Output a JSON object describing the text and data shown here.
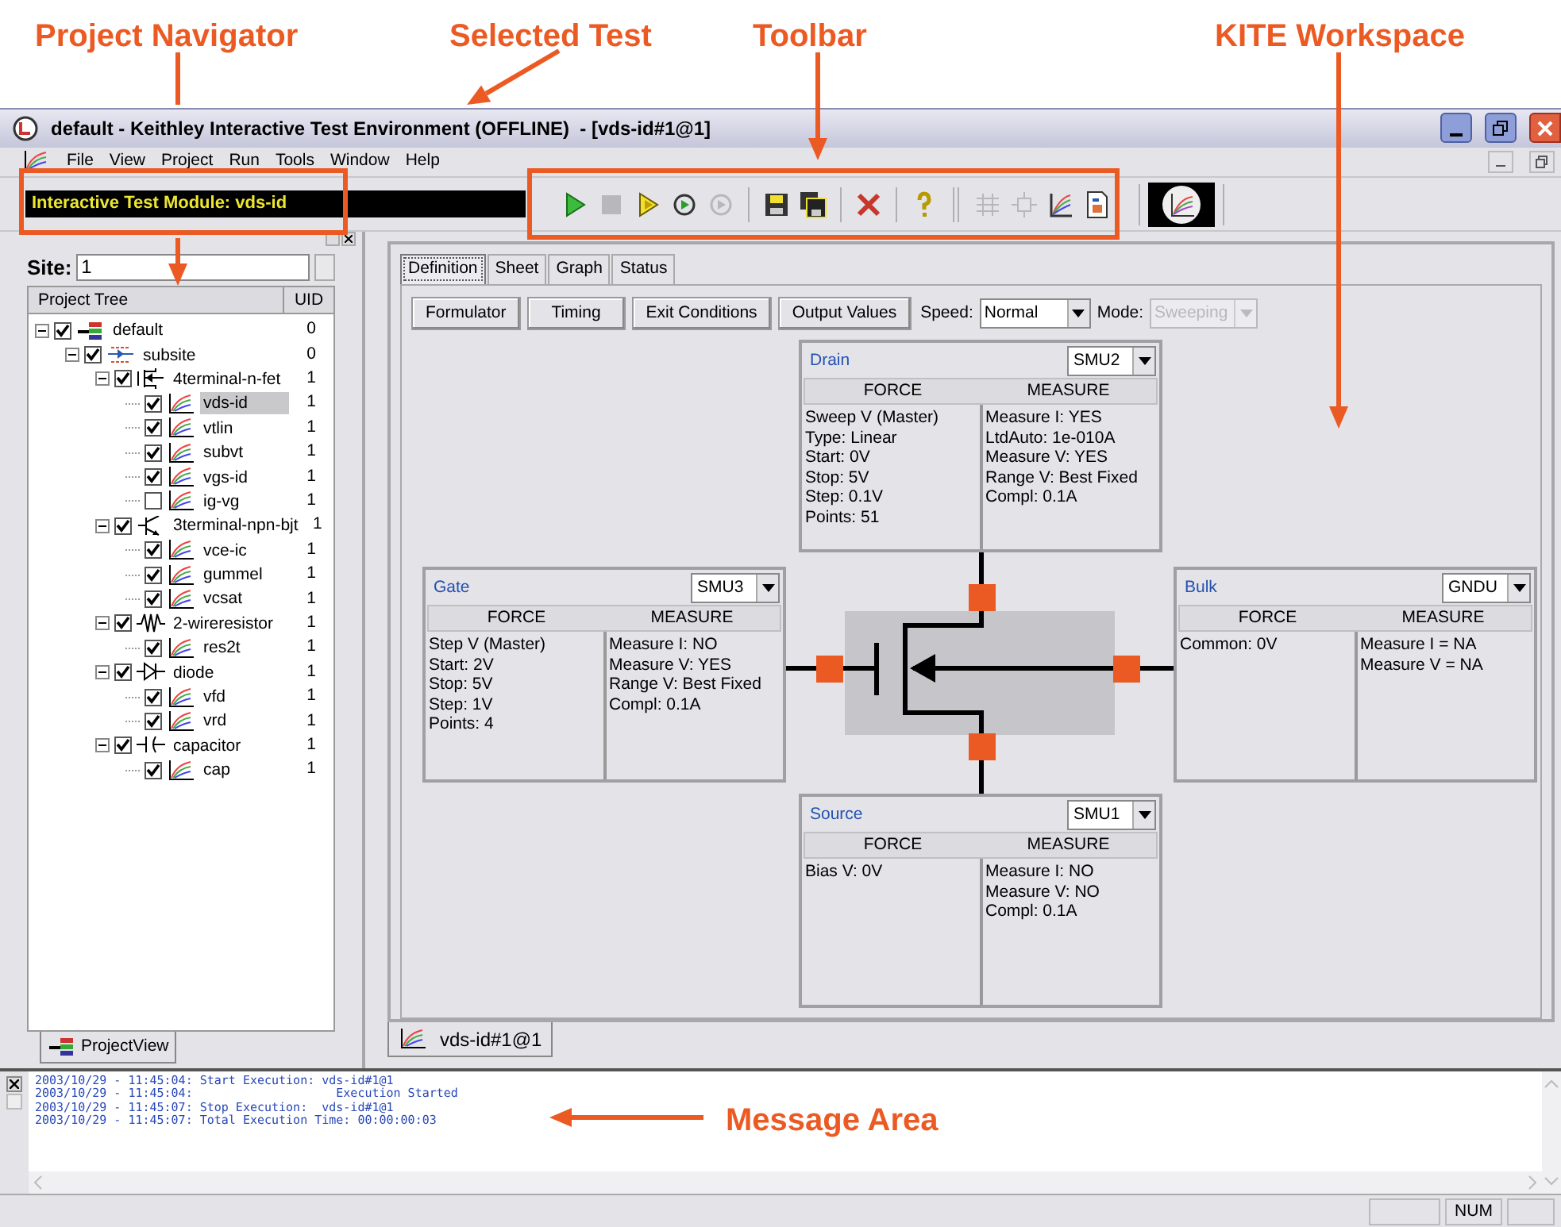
{
  "callouts": [
    {
      "text": "Project Navigator"
    },
    {
      "text": "Selected Test"
    },
    {
      "text": "Toolbar"
    },
    {
      "text": "KITE Workspace"
    },
    {
      "text": "Message Area"
    }
  ],
  "window": {
    "title": "default - Keithley Interactive Test Environment (OFFLINE)  - [vds-id#1@1]"
  },
  "menu": [
    "File",
    "View",
    "Project",
    "Run",
    "Tools",
    "Window",
    "Help"
  ],
  "toolbar": {
    "module_label": "Interactive Test Module: vds-id",
    "buttons": [
      {
        "kind": "run",
        "disabled": false
      },
      {
        "kind": "stop",
        "disabled": true
      },
      {
        "kind": "run-step",
        "disabled": false
      },
      {
        "kind": "cycle",
        "disabled": false
      },
      {
        "kind": "cycle",
        "disabled": true
      },
      {
        "kind": "sep"
      },
      {
        "kind": "save",
        "disabled": false
      },
      {
        "kind": "save-all",
        "disabled": false
      },
      {
        "kind": "sep"
      },
      {
        "kind": "delete",
        "disabled": false
      },
      {
        "kind": "sep"
      },
      {
        "kind": "help",
        "disabled": false
      },
      {
        "kind": "sep2"
      },
      {
        "kind": "grid",
        "disabled": true
      },
      {
        "kind": "chip",
        "disabled": true
      },
      {
        "kind": "graph",
        "disabled": false
      },
      {
        "kind": "doc",
        "disabled": false
      }
    ]
  },
  "site": {
    "label": "Site:",
    "value": "1"
  },
  "project_tree": {
    "columns": [
      "Project Tree",
      "UID"
    ],
    "nodes": [
      {
        "label": "default",
        "uid": "0",
        "kind": "project",
        "checked": true,
        "selected": false,
        "expanded": true,
        "children": [
          {
            "label": "subsite",
            "uid": "0",
            "kind": "subsite",
            "checked": true,
            "selected": false,
            "expanded": true,
            "children": [
              {
                "label": "4terminal-n-fet",
                "uid": "1",
                "kind": "fet",
                "checked": true,
                "selected": false,
                "expanded": true,
                "children": [
                  {
                    "label": "vds-id",
                    "uid": "1",
                    "kind": "test",
                    "checked": true,
                    "selected": true
                  },
                  {
                    "label": "vtlin",
                    "uid": "1",
                    "kind": "test",
                    "checked": true,
                    "selected": false
                  },
                  {
                    "label": "subvt",
                    "uid": "1",
                    "kind": "test",
                    "checked": true,
                    "selected": false
                  },
                  {
                    "label": "vgs-id",
                    "uid": "1",
                    "kind": "test",
                    "checked": true,
                    "selected": false
                  },
                  {
                    "label": "ig-vg",
                    "uid": "1",
                    "kind": "test",
                    "checked": false,
                    "selected": false
                  }
                ]
              },
              {
                "label": "3terminal-npn-bjt",
                "uid": "1",
                "kind": "bjt",
                "checked": true,
                "selected": false,
                "expanded": true,
                "children": [
                  {
                    "label": "vce-ic",
                    "uid": "1",
                    "kind": "test",
                    "checked": true,
                    "selected": false
                  },
                  {
                    "label": "gummel",
                    "uid": "1",
                    "kind": "test",
                    "checked": true,
                    "selected": false
                  },
                  {
                    "label": "vcsat",
                    "uid": "1",
                    "kind": "test",
                    "checked": true,
                    "selected": false
                  }
                ]
              },
              {
                "label": "2-wireresistor",
                "uid": "1",
                "kind": "resistor",
                "checked": true,
                "selected": false,
                "expanded": true,
                "children": [
                  {
                    "label": "res2t",
                    "uid": "1",
                    "kind": "test",
                    "checked": true,
                    "selected": false
                  }
                ]
              },
              {
                "label": "diode",
                "uid": "1",
                "kind": "diode",
                "checked": true,
                "selected": false,
                "expanded": true,
                "children": [
                  {
                    "label": "vfd",
                    "uid": "1",
                    "kind": "test",
                    "checked": true,
                    "selected": false
                  },
                  {
                    "label": "vrd",
                    "uid": "1",
                    "kind": "test",
                    "checked": true,
                    "selected": false
                  }
                ]
              },
              {
                "label": "capacitor",
                "uid": "1",
                "kind": "capacitor",
                "checked": true,
                "selected": false,
                "expanded": true,
                "children": [
                  {
                    "label": "cap",
                    "uid": "1",
                    "kind": "test",
                    "checked": true,
                    "selected": false
                  }
                ]
              }
            ]
          }
        ]
      }
    ]
  },
  "navigator_tab": {
    "label": "ProjectView"
  },
  "workspace": {
    "tabs": [
      {
        "label": "Definition",
        "selected": true
      },
      {
        "label": "Sheet",
        "selected": false
      },
      {
        "label": "Graph",
        "selected": false
      },
      {
        "label": "Status",
        "selected": false
      }
    ],
    "buttons": [
      "Formulator",
      "Timing",
      "Exit Conditions",
      "Output Values"
    ],
    "speed": {
      "label": "Speed:",
      "value": "Normal"
    },
    "mode": {
      "label": "Mode:",
      "value": "Sweeping",
      "disabled": true
    },
    "terminals": [
      {
        "name": "Drain",
        "instrument": "SMU2",
        "columns": [
          "FORCE",
          "MEASURE"
        ],
        "force": [
          "Sweep V (Master)",
          "Type: Linear",
          "Start: 0V",
          "Stop: 5V",
          "Step: 0.1V",
          "Points: 51"
        ],
        "measure": [
          "Measure I: YES",
          "LtdAuto: 1e-010A",
          "Measure V: YES",
          "Range V: Best Fixed",
          "Compl: 0.1A"
        ]
      },
      {
        "name": "Gate",
        "instrument": "SMU3",
        "columns": [
          "FORCE",
          "MEASURE"
        ],
        "force": [
          "Step V (Master)",
          "Start: 2V",
          "Stop: 5V",
          "Step: 1V",
          "Points: 4"
        ],
        "measure": [
          "Measure I: NO",
          "Measure V: YES",
          "Range V: Best Fixed",
          "Compl: 0.1A"
        ]
      },
      {
        "name": "Bulk",
        "instrument": "GNDU",
        "columns": [
          "FORCE",
          "MEASURE"
        ],
        "force": [
          "Common: 0V"
        ],
        "measure": [
          "Measure I = NA",
          "Measure V = NA"
        ]
      },
      {
        "name": "Source",
        "instrument": "SMU1",
        "columns": [
          "FORCE",
          "MEASURE"
        ],
        "force": [
          "Bias V: 0V"
        ],
        "measure": [
          "Measure I: NO",
          "Measure V: NO",
          "Compl: 0.1A"
        ]
      }
    ],
    "document_tab": {
      "label": "vds-id#1@1"
    }
  },
  "messages": [
    "2003/10/29 - 11:45:04: Start Execution: vds-id#1@1",
    "2003/10/29 - 11:45:04:                    Execution Started",
    "2003/10/29 - 11:45:07: Stop Execution:  vds-id#1@1",
    "2003/10/29 - 11:45:07: Total Execution Time: 00:00:00:03"
  ],
  "status_bar": {
    "indicator": "NUM"
  }
}
